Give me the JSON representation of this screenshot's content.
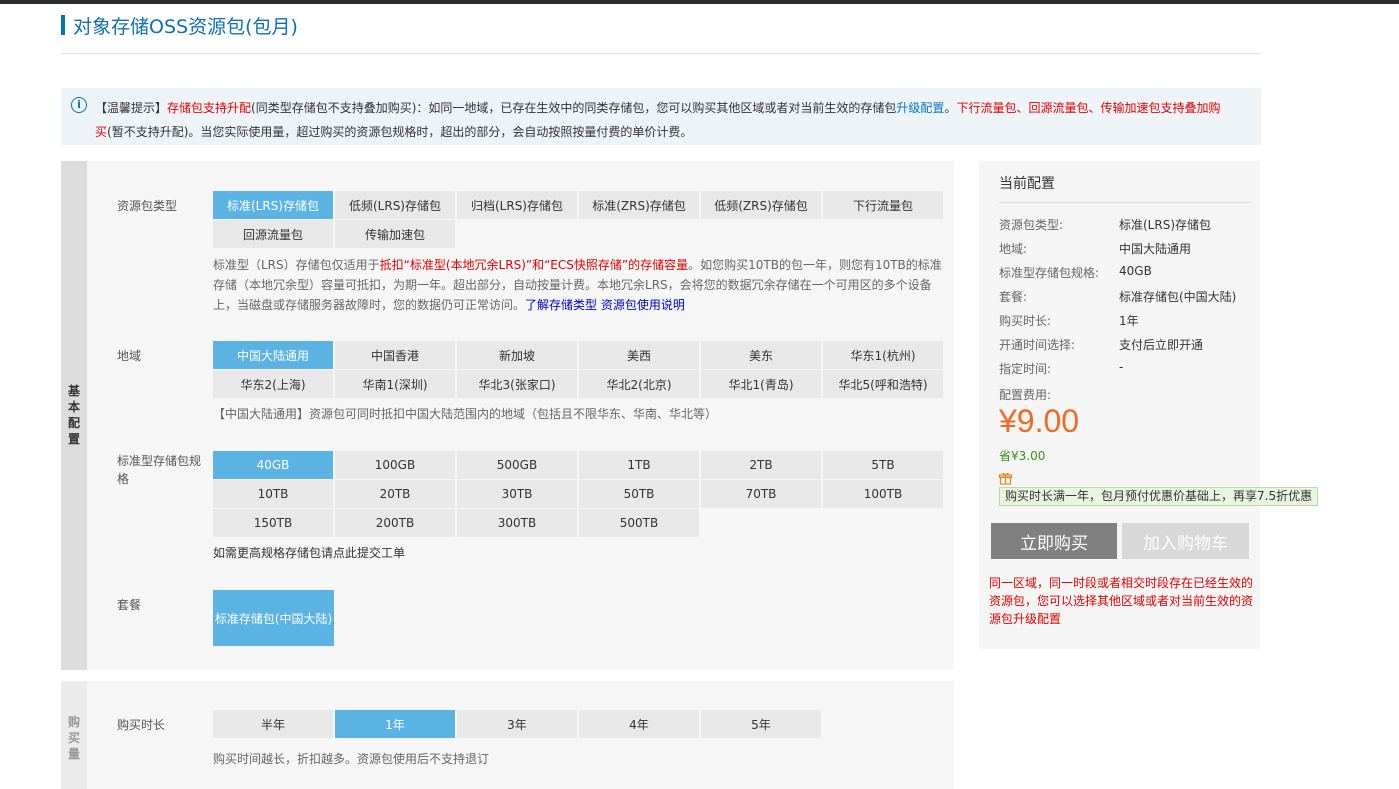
{
  "page_title": "对象存储OSS资源包(包月)",
  "notice": {
    "p1": "【温馨提示】",
    "p2": "存储包支持升配",
    "p3": "(同类型存储包不支持叠加购买)：如同一地域，已存在生效中的同类存储包，您可以购买其他区域或者对当前生效的存储包",
    "p4": "升级配置",
    "p5": "。",
    "p6": "下行流量包、回源流量包、传输加速包支持叠加购买",
    "p7": "(暂不支持升配)。当您实际使用量，超过购买的资源包规格时，超出的部分，会自动按照按量付费的单价计费。"
  },
  "basic_tab": [
    "基",
    "本",
    "配",
    "置"
  ],
  "buy_tab": [
    "购",
    "买",
    "量"
  ],
  "package_type": {
    "label": "资源包类型",
    "options": [
      "标准(LRS)存储包",
      "低频(LRS)存储包",
      "归档(LRS)存储包",
      "标准(ZRS)存储包",
      "低频(ZRS)存储包",
      "下行流量包",
      "回源流量包",
      "传输加速包"
    ],
    "selected": 0,
    "desc_a": "标准型（LRS）存储包仅适用于",
    "desc_b": "抵扣“标准型(本地冗余LRS)”和“ECS快照存储”的存储容量",
    "desc_c": "。如您购买10TB的包一年，则您有10TB的标准存储（本地冗余型）容量可抵扣，为期一年。超出部分，自动按量计费。本地冗余LRS，会将您的数据冗余存储在一个可用区的多个设备上，当磁盘或存储服务器故障时，您的数据仍可正常访问。",
    "link1": "了解存储类型",
    "link2": "资源包使用说明"
  },
  "region": {
    "label": "地域",
    "options": [
      "中国大陆通用",
      "中国香港",
      "新加坡",
      "美西",
      "美东",
      "华东1(杭州)",
      "华东2(上海)",
      "华南1(深圳)",
      "华北3(张家口)",
      "华北2(北京)",
      "华北1(青岛)",
      "华北5(呼和浩特)"
    ],
    "selected": 0,
    "desc": "【中国大陆通用】资源包可同时抵扣中国大陆范围内的地域（包括且不限华东、华南、华北等）"
  },
  "spec": {
    "label_1": "标准型存储包规",
    "label_2": "格",
    "options": [
      "40GB",
      "100GB",
      "500GB",
      "1TB",
      "2TB",
      "5TB",
      "10TB",
      "20TB",
      "30TB",
      "50TB",
      "70TB",
      "100TB",
      "150TB",
      "200TB",
      "300TB",
      "500TB"
    ],
    "selected": 0,
    "desc_a": "如需更高规格存储包请",
    "desc_link": "点此提交工单"
  },
  "plan": {
    "label": "套餐",
    "option": "标准存储包(中国大陆)"
  },
  "duration": {
    "label": "购买时长",
    "options": [
      "半年",
      "1年",
      "3年",
      "4年",
      "5年"
    ],
    "selected": 1,
    "desc": "购买时间越长，折扣越多。资源包使用后不支持退订"
  },
  "summary": {
    "title": "当前配置",
    "rows": [
      {
        "k": "资源包类型:",
        "v": "标准(LRS)存储包"
      },
      {
        "k": "地域:",
        "v": "中国大陆通用"
      },
      {
        "k": "标准型存储包规格:",
        "v": "40GB"
      },
      {
        "k": "套餐:",
        "v": "标准存储包(中国大陆)"
      },
      {
        "k": "购买时长:",
        "v": "1年"
      },
      {
        "k": "开通时间选择:",
        "v": "支付后立即开通"
      },
      {
        "k": "指定时间:",
        "v": "-"
      }
    ],
    "fee_label": "配置费用:",
    "price": "¥9.00",
    "save": "省¥3.00",
    "gift_icon": "gift-icon",
    "tip": "购买时长满一年，包月预付优惠价基础上，再享7.5折优惠",
    "buy_now": "立即购买",
    "add_cart": "加入购物车",
    "warning": "同一区域，同一时段或者相交时段存在已经生效的资源包，您可以选择其他区域或者对当前生效的资源包升级配置"
  },
  "colors": {
    "accent": "#0077b3",
    "selected": "#5ab3e3",
    "price": "#f16a22",
    "save": "#3a8f1e",
    "warning": "#e30000",
    "buy_btn": "#808080",
    "cart_btn": "#d8d8d8"
  }
}
